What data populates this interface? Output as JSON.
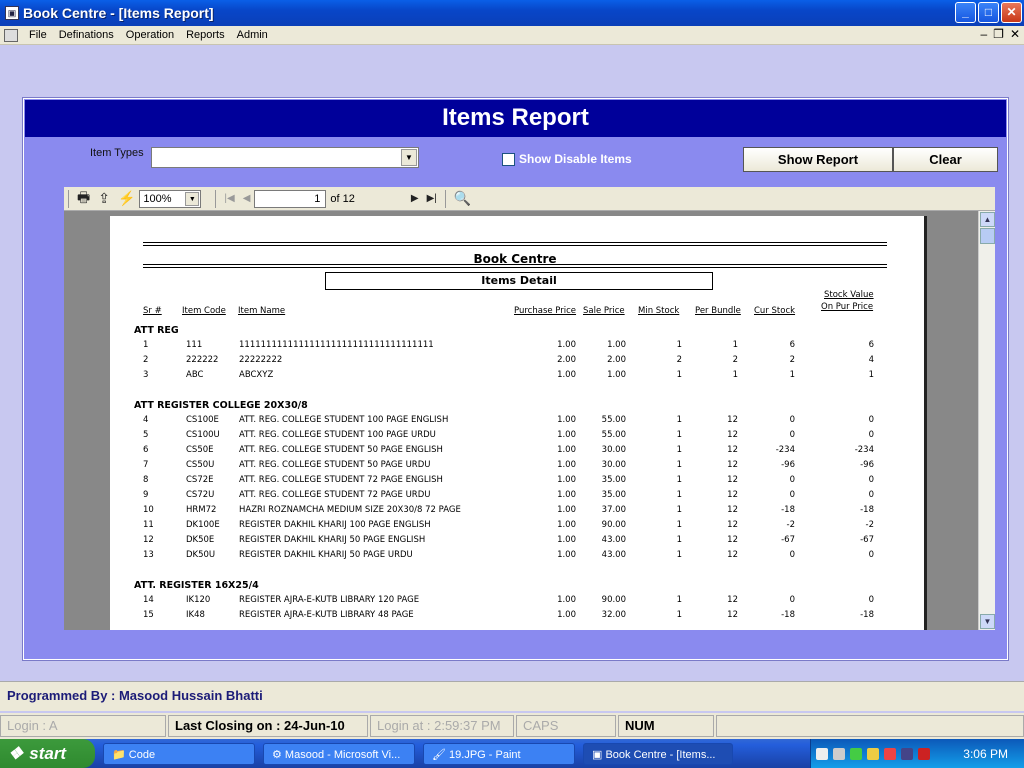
{
  "window": {
    "title": "Book Centre  - [Items Report]",
    "min": "_",
    "max": "□",
    "close": "✕"
  },
  "menu": [
    "File",
    "Definations",
    "Operation",
    "Reports",
    "Admin"
  ],
  "report": {
    "header": "Items Report",
    "item_types_label": "Item Types",
    "item_types_value": "",
    "show_disable": "Show Disable Items",
    "show_report": "Show Report",
    "clear": "Clear"
  },
  "viewer": {
    "zoom": "100%",
    "page": "1",
    "of": "of 12"
  },
  "doc": {
    "title": "Book Centre",
    "subtitle": "Items Detail",
    "columns": {
      "sr": "Sr #",
      "code": "Item Code",
      "name": "Item Name",
      "purchase": "Purchase Price",
      "sale": "Sale Price",
      "min": "Min Stock",
      "per": "Per Bundle",
      "cur": "Cur Stock",
      "sv1": "Stock Value",
      "sv2": "On Pur Price"
    },
    "groups": [
      {
        "name": "ATT REG",
        "rows": [
          {
            "sr": "1",
            "code": "111",
            "name": "111111111111111111111111111111111111",
            "pp": "1.00",
            "sp": "1.00",
            "min": "1",
            "per": "1",
            "cur": "6",
            "sv": "6"
          },
          {
            "sr": "2",
            "code": "222222",
            "name": "22222222",
            "pp": "2.00",
            "sp": "2.00",
            "min": "2",
            "per": "2",
            "cur": "2",
            "sv": "4"
          },
          {
            "sr": "3",
            "code": "ABC",
            "name": "ABCXYZ",
            "pp": "1.00",
            "sp": "1.00",
            "min": "1",
            "per": "1",
            "cur": "1",
            "sv": "1"
          }
        ]
      },
      {
        "name": "ATT REGISTER COLLEGE 20X30/8",
        "rows": [
          {
            "sr": "4",
            "code": "CS100E",
            "name": "ATT. REG. COLLEGE STUDENT 100 PAGE ENGLISH",
            "pp": "1.00",
            "sp": "55.00",
            "min": "1",
            "per": "12",
            "cur": "0",
            "sv": "0"
          },
          {
            "sr": "5",
            "code": "CS100U",
            "name": "ATT. REG. COLLEGE STUDENT 100 PAGE URDU",
            "pp": "1.00",
            "sp": "55.00",
            "min": "1",
            "per": "12",
            "cur": "0",
            "sv": "0"
          },
          {
            "sr": "6",
            "code": "CS50E",
            "name": "ATT. REG. COLLEGE STUDENT 50 PAGE ENGLISH",
            "pp": "1.00",
            "sp": "30.00",
            "min": "1",
            "per": "12",
            "cur": "-234",
            "sv": "-234"
          },
          {
            "sr": "7",
            "code": "CS50U",
            "name": "ATT. REG. COLLEGE STUDENT 50 PAGE URDU",
            "pp": "1.00",
            "sp": "30.00",
            "min": "1",
            "per": "12",
            "cur": "-96",
            "sv": "-96"
          },
          {
            "sr": "8",
            "code": "CS72E",
            "name": "ATT. REG. COLLEGE STUDENT 72 PAGE ENGLISH",
            "pp": "1.00",
            "sp": "35.00",
            "min": "1",
            "per": "12",
            "cur": "0",
            "sv": "0"
          },
          {
            "sr": "9",
            "code": "CS72U",
            "name": "ATT. REG. COLLEGE STUDENT 72 PAGE URDU",
            "pp": "1.00",
            "sp": "35.00",
            "min": "1",
            "per": "12",
            "cur": "0",
            "sv": "0"
          },
          {
            "sr": "10",
            "code": "HRM72",
            "name": "HAZRI ROZNAMCHA MEDIUM SIZE 20X30/8 72 PAGE",
            "pp": "1.00",
            "sp": "37.00",
            "min": "1",
            "per": "12",
            "cur": "-18",
            "sv": "-18"
          },
          {
            "sr": "11",
            "code": "DK100E",
            "name": "REGISTER DAKHIL KHARIJ 100 PAGE ENGLISH",
            "pp": "1.00",
            "sp": "90.00",
            "min": "1",
            "per": "12",
            "cur": "-2",
            "sv": "-2"
          },
          {
            "sr": "12",
            "code": "DK50E",
            "name": "REGISTER DAKHIL KHARIJ 50 PAGE ENGLISH",
            "pp": "1.00",
            "sp": "43.00",
            "min": "1",
            "per": "12",
            "cur": "-67",
            "sv": "-67"
          },
          {
            "sr": "13",
            "code": "DK50U",
            "name": "REGISTER DAKHIL KHARIJ 50 PAGE URDU",
            "pp": "1.00",
            "sp": "43.00",
            "min": "1",
            "per": "12",
            "cur": "0",
            "sv": "0"
          }
        ]
      },
      {
        "name": "ATT. REGISTER 16X25/4",
        "rows": [
          {
            "sr": "14",
            "code": "IK120",
            "name": "REGISTER AJRA-E-KUTB LIBRARY 120 PAGE",
            "pp": "1.00",
            "sp": "90.00",
            "min": "1",
            "per": "12",
            "cur": "0",
            "sv": "0"
          },
          {
            "sr": "15",
            "code": "IK48",
            "name": "REGISTER AJRA-E-KUTB LIBRARY 48 PAGE",
            "pp": "1.00",
            "sp": "32.00",
            "min": "1",
            "per": "12",
            "cur": "-18",
            "sv": "-18"
          }
        ]
      }
    ]
  },
  "footer": {
    "programmed_by": "Programmed By : Masood Hussain Bhatti"
  },
  "status": {
    "login": "Login :  A",
    "closing": "Last Closing on : 24-Jun-10",
    "login_at": "Login at : 2:59:37 PM",
    "caps": "CAPS",
    "num": "NUM"
  },
  "taskbar": {
    "start": "start",
    "tasks": [
      "Code",
      "Masood - Microsoft Vi...",
      "19.JPG - Paint",
      "Book Centre  - [Items..."
    ],
    "clock": "3:06 PM"
  }
}
